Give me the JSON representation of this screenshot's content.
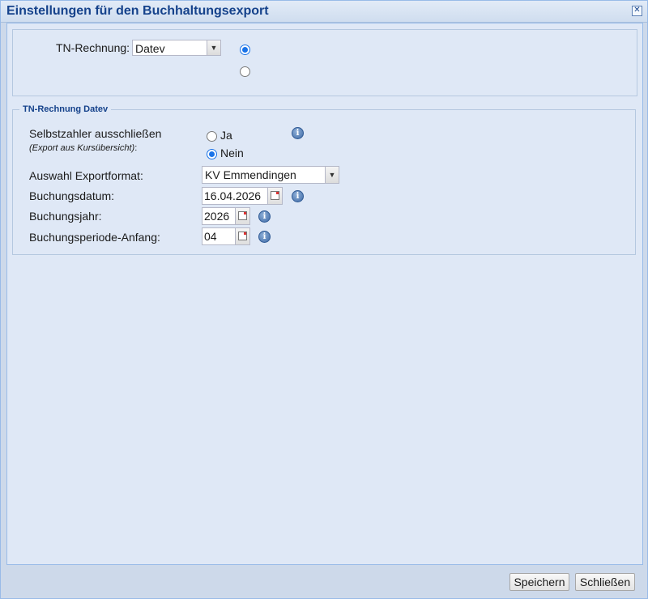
{
  "dialog": {
    "title": "Einstellungen für den Buchhaltungsexport",
    "close_symbol": "✕"
  },
  "tn_rechnung": {
    "label": "TN-Rechnung:",
    "selected": "Datev",
    "radio_options": [
      {
        "checked": true
      },
      {
        "checked": false
      }
    ]
  },
  "datev_section": {
    "legend": "TN-Rechnung Datev",
    "selbstzahler": {
      "label": "Selbstzahler ausschließen",
      "sublabel": "(Export aus Kursübersicht)",
      "sublabel_colon": ":",
      "option_ja": "Ja",
      "option_nein": "Nein",
      "selected": "Nein"
    },
    "exportformat": {
      "label": "Auswahl Exportformat:",
      "selected": "KV Emmendingen"
    },
    "buchungsdatum": {
      "label": "Buchungsdatum:",
      "value": "16.04.2026"
    },
    "buchungsjahr": {
      "label": "Buchungsjahr:",
      "value": "2026"
    },
    "buchungsperiode": {
      "label": "Buchungsperiode-Anfang:",
      "value": "04"
    },
    "info_glyph": "i"
  },
  "footer": {
    "save_label": "Speichern",
    "close_label": "Schließen"
  }
}
